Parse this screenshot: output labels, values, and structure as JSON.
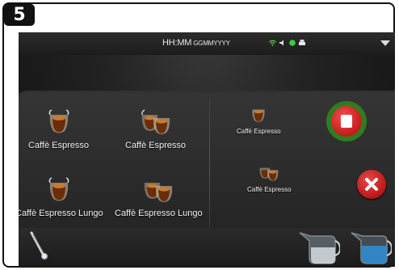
{
  "step": {
    "number": "5"
  },
  "status_bar": {
    "time": "HH:MM",
    "date": "GGMMYYYY",
    "icons": [
      "wifi-icon",
      "speaker-icon",
      "green-status-icon",
      "printer-icon"
    ],
    "dropdown_icon": "chevron-down-icon"
  },
  "left_items": [
    {
      "label": "Caffè Espresso",
      "icon": "single-cup-icon"
    },
    {
      "label": "Caffè Espresso",
      "icon": "double-cup-icon"
    },
    {
      "label": "Caffè Espresso Lungo",
      "icon": "single-cup-icon"
    },
    {
      "label": "Caffè Espresso Lungo",
      "icon": "double-cup-icon"
    }
  ],
  "right_items": [
    {
      "label": "Caffè Espresso",
      "icon": "single-cup-icon"
    },
    {
      "label": "Caffè Espresso",
      "icon": "double-cup-icon"
    }
  ],
  "buttons": {
    "stop": "stop-icon",
    "cancel": "close-icon"
  },
  "bottom_icons": [
    "steam-wand-icon",
    "milk-jug-icon",
    "water-jug-icon"
  ],
  "colors": {
    "stop_ring": "#2e7d1f",
    "stop_red": "#d42020",
    "cancel_red": "#d02a2a"
  }
}
